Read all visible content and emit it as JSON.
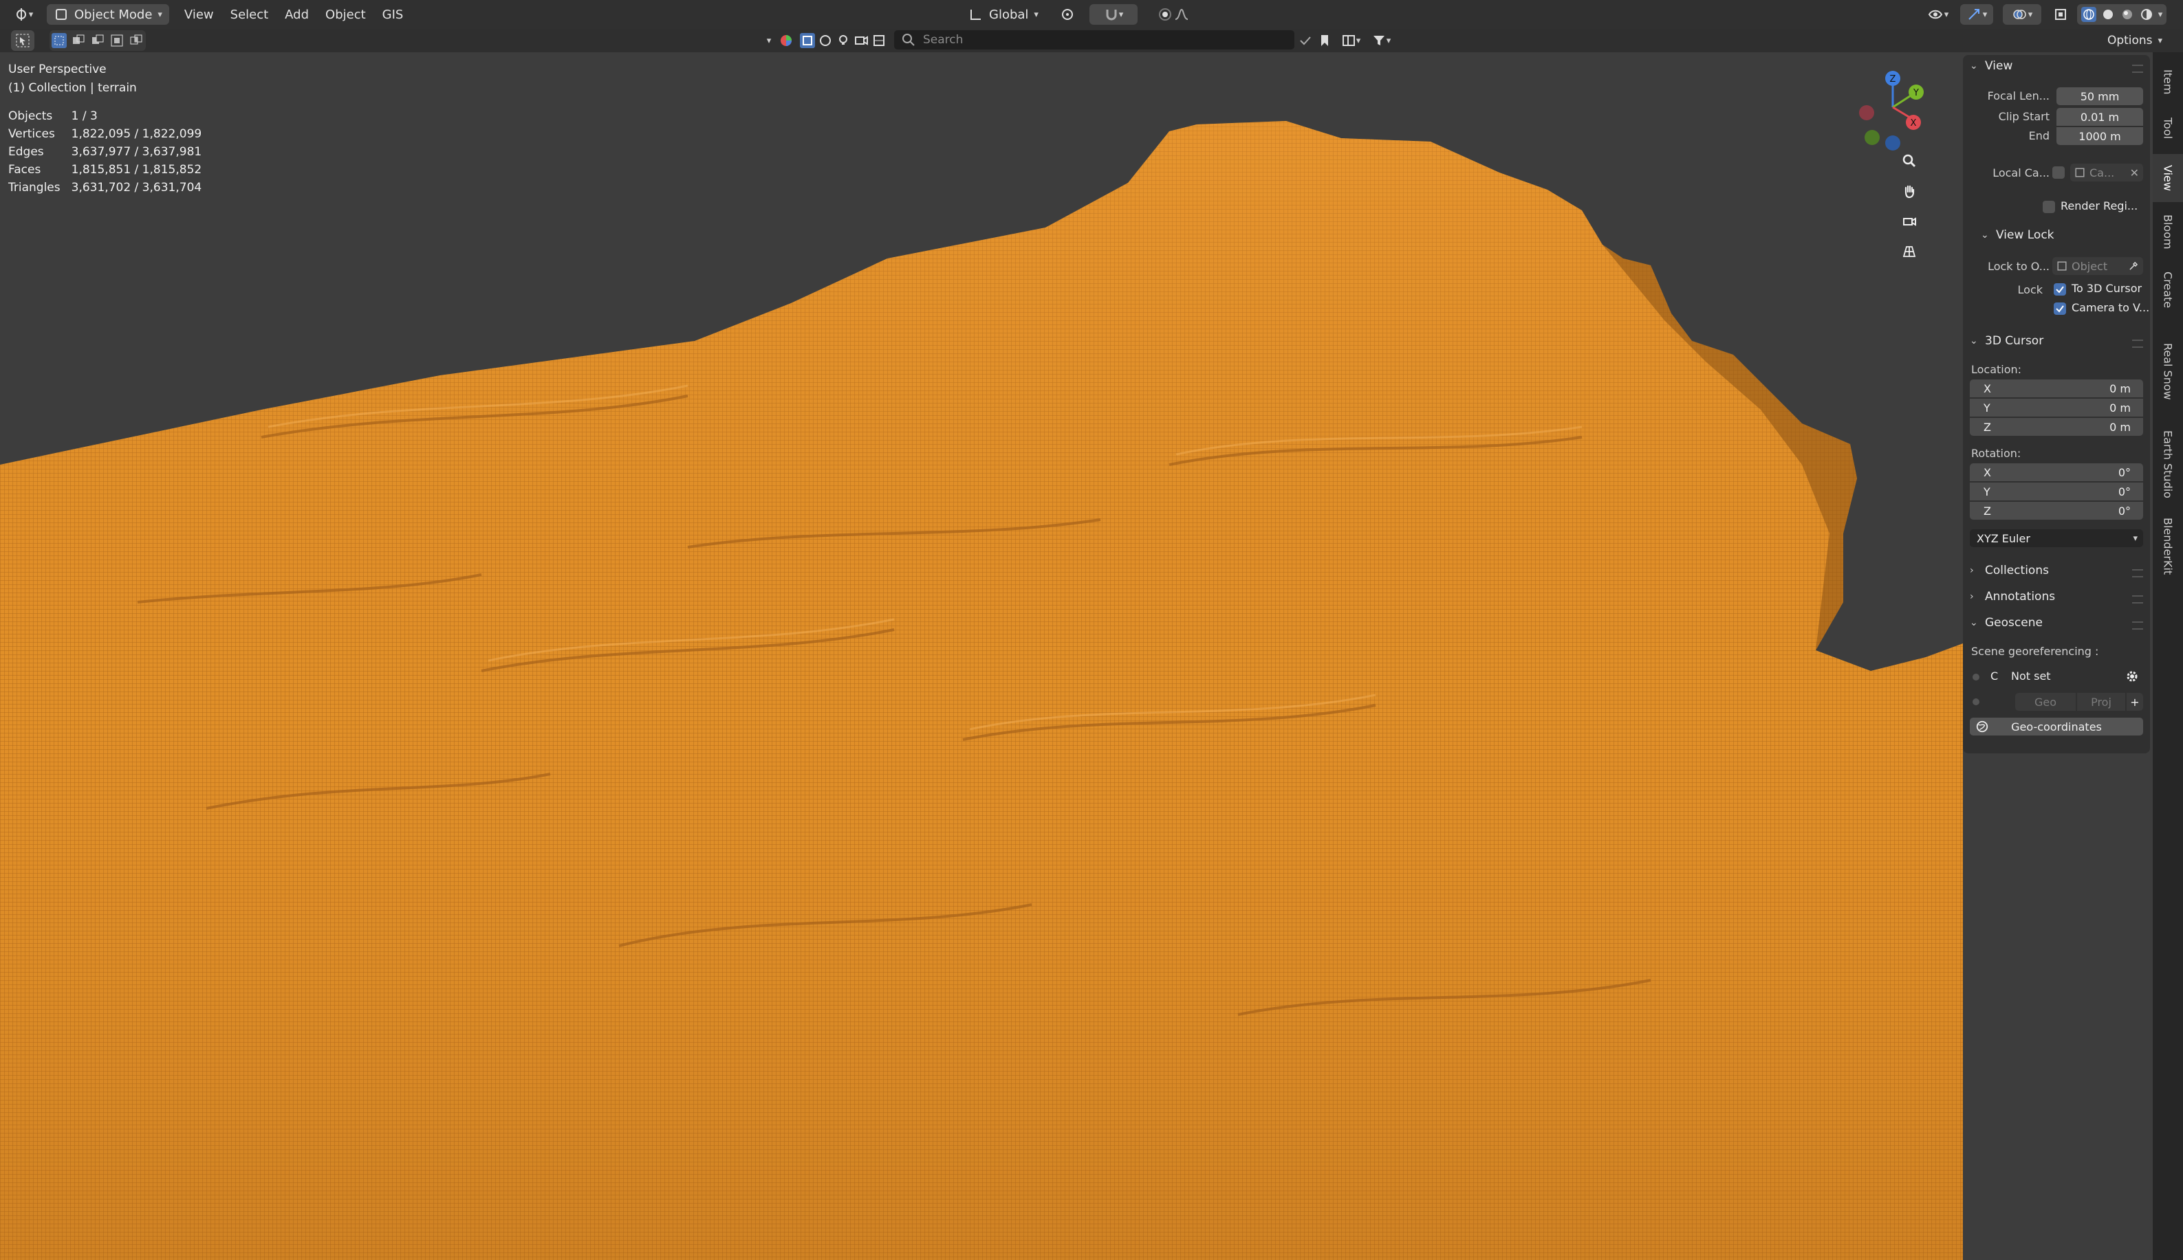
{
  "header": {
    "mode": "Object Mode",
    "menus": [
      "View",
      "Select",
      "Add",
      "Object",
      "GIS"
    ],
    "orientation": "Global",
    "search_placeholder": "Search",
    "options": "Options"
  },
  "viewport": {
    "perspective": "User Perspective",
    "collection": "(1) Collection | terrain",
    "stats": [
      {
        "label": "Objects",
        "value": "1 / 3"
      },
      {
        "label": "Vertices",
        "value": "1,822,095 / 1,822,099"
      },
      {
        "label": "Edges",
        "value": "3,637,977 / 3,637,981"
      },
      {
        "label": "Faces",
        "value": "1,815,851 / 1,815,852"
      },
      {
        "label": "Triangles",
        "value": "3,631,702 / 3,631,704"
      }
    ],
    "gizmo": {
      "z": "Z",
      "y": "Y",
      "x": "X"
    },
    "colors": {
      "terrain": "#e0902a",
      "terrain_dark": "#a8621a",
      "background": "#3d3d3d"
    }
  },
  "sidebar": {
    "view": {
      "title": "View",
      "focal_length_label": "Focal Len...",
      "focal_length": "50 mm",
      "clip_start_label": "Clip Start",
      "clip_start": "0.01 m",
      "end_label": "End",
      "end": "1000 m",
      "local_camera_label": "Local Ca...",
      "local_camera_value": "Ca...",
      "render_region": "Render Regi..."
    },
    "view_lock": {
      "title": "View Lock",
      "lock_to_object_label": "Lock to O...",
      "lock_to_object_placeholder": "Object",
      "lock_label": "Lock",
      "to_3d_cursor": "To 3D Cursor",
      "camera_to_view": "Camera to V..."
    },
    "cursor": {
      "title": "3D Cursor",
      "location_label": "Location:",
      "location": [
        {
          "axis": "X",
          "value": "0 m"
        },
        {
          "axis": "Y",
          "value": "0 m"
        },
        {
          "axis": "Z",
          "value": "0 m"
        }
      ],
      "rotation_label": "Rotation:",
      "rotation": [
        {
          "axis": "X",
          "value": "0°"
        },
        {
          "axis": "Y",
          "value": "0°"
        },
        {
          "axis": "Z",
          "value": "0°"
        }
      ],
      "rotation_mode": "XYZ Euler"
    },
    "collections": "Collections",
    "annotations": "Annotations",
    "geoscene": {
      "title": "Geoscene",
      "scene_georef_label": "Scene georeferencing :",
      "crs_letter": "C",
      "crs_value": "Not set",
      "geo": "Geo",
      "proj": "Proj",
      "geo_coordinates": "Geo-coordinates"
    }
  },
  "tabs": [
    "Item",
    "Tool",
    "View",
    "Bloom",
    "Create",
    "Real Snow",
    "Earth Studio",
    "BlenderKit"
  ]
}
